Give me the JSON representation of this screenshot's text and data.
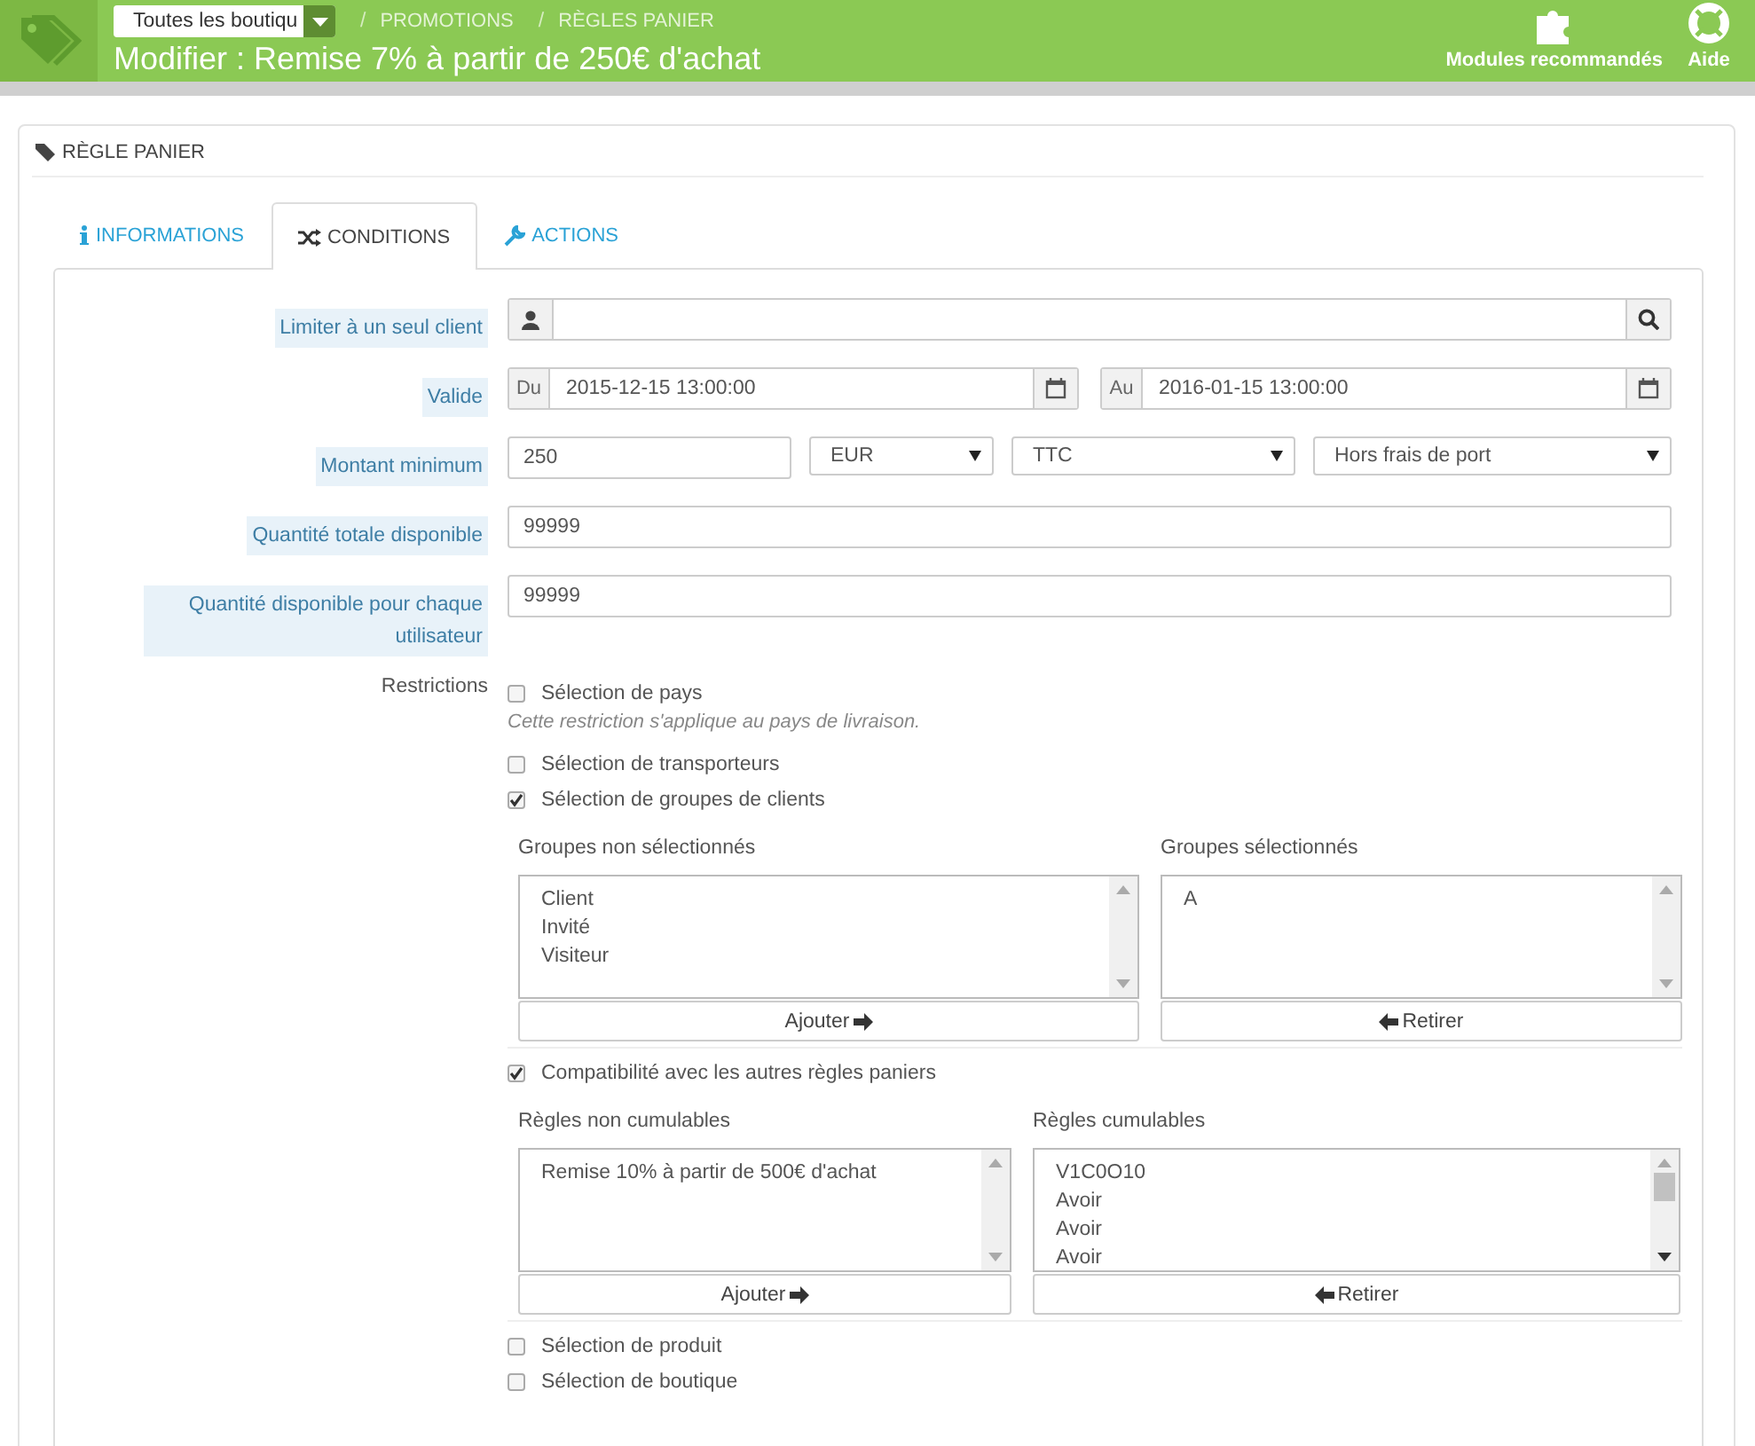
{
  "header": {
    "shop_selector": "Toutes les boutiqu",
    "breadcrumb": [
      {
        "separator": "/",
        "label": "PROMOTIONS"
      },
      {
        "separator": "/",
        "label": "RÈGLES PANIER"
      }
    ],
    "title": "Modifier : Remise 7% à partir de 250€ d'achat",
    "toolbar": [
      {
        "label": "Modules recommandés",
        "kind": "puzzle"
      },
      {
        "label": "Aide",
        "kind": "help"
      }
    ]
  },
  "panel_title": "RÈGLE PANIER",
  "tabs": [
    {
      "label": "INFORMATIONS",
      "kind": "info",
      "selected": false
    },
    {
      "label": "CONDITIONS",
      "kind": "shuffle",
      "selected": true
    },
    {
      "label": "ACTIONS",
      "kind": "wrench",
      "selected": false
    }
  ],
  "fields": [
    {
      "kind": "search",
      "label": "Limiter à un seul client"
    },
    {
      "kind": "daterange",
      "label": "Valide",
      "from_addon": "Du",
      "from": "2015-12-15 13:00:00",
      "to_addon": "Au",
      "to": "2016-01-15 13:00:00"
    },
    {
      "kind": "amount",
      "label": "Montant minimum",
      "value": "250",
      "selects": [
        "EUR",
        "TTC",
        "Hors frais de port"
      ]
    },
    {
      "kind": "text",
      "label": "Quantité totale disponible",
      "value": "99999"
    },
    {
      "kind": "text",
      "label": "Quantité disponible pour chaque utilisateur",
      "value": "99999"
    }
  ],
  "restrictions": {
    "label": "Restrictions",
    "items": [
      {
        "kind": "checkbox",
        "label": "Sélection de pays",
        "checked": false
      },
      {
        "kind": "hint",
        "text": "Cette restriction s'applique au pays de livraison."
      },
      {
        "kind": "checkbox",
        "label": "Sélection de transporteurs",
        "checked": false
      },
      {
        "kind": "checkbox",
        "label": "Sélection de groupes de clients",
        "checked": true
      },
      {
        "kind": "duallist",
        "narrow": false,
        "left": {
          "title": "Groupes non sélectionnés",
          "options": [
            "Client",
            "Invité",
            "Visiteur"
          ],
          "button": "Ajouter"
        },
        "right": {
          "title": "Groupes sélectionnés",
          "options": [
            "A"
          ],
          "button": "Retirer"
        }
      },
      {
        "kind": "checkbox",
        "label": "Compatibilité avec les autres règles paniers",
        "checked": true
      },
      {
        "kind": "duallist",
        "narrow": true,
        "left": {
          "title": "Règles non cumulables",
          "options": [
            "Remise 10% à partir de 500€ d'achat"
          ],
          "button": "Ajouter"
        },
        "right": {
          "title": "Règles cumulables",
          "options": [
            "V1C0O10",
            "Avoir",
            "Avoir",
            "Avoir"
          ],
          "button": "Retirer"
        }
      },
      {
        "kind": "checkbox",
        "label": "Sélection de produit",
        "checked": false
      },
      {
        "kind": "checkbox",
        "label": "Sélection de boutique",
        "checked": false
      }
    ]
  }
}
